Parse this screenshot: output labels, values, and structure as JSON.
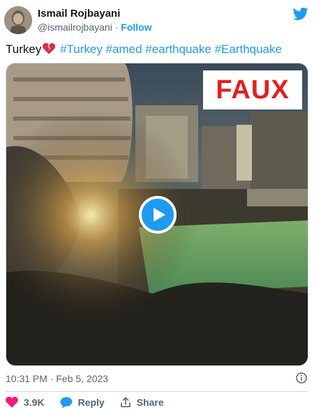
{
  "author": {
    "name": "Ismail Rojbayani",
    "handle": "@ismailrojbayani",
    "separator": "·",
    "follow_label": "Follow"
  },
  "tweet": {
    "text_start": "Turkey",
    "emoji": "broken-heart-icon",
    "hashtags": [
      "#Turkey",
      "#amed",
      "#earthquake",
      "#Earthquake"
    ]
  },
  "media": {
    "overlay_label": "FAUX",
    "overlay_color": "#e51f1f",
    "play_icon": "play-icon"
  },
  "meta": {
    "timestamp": "10:31 PM · Feb 5, 2023",
    "info_icon": "info-icon"
  },
  "actions": {
    "like_count": "3.9K",
    "reply_label": "Reply",
    "share_label": "Share"
  },
  "colors": {
    "accent": "#1d9bf0",
    "like": "#f91880",
    "text": "#0f1419",
    "muted": "#536471"
  }
}
